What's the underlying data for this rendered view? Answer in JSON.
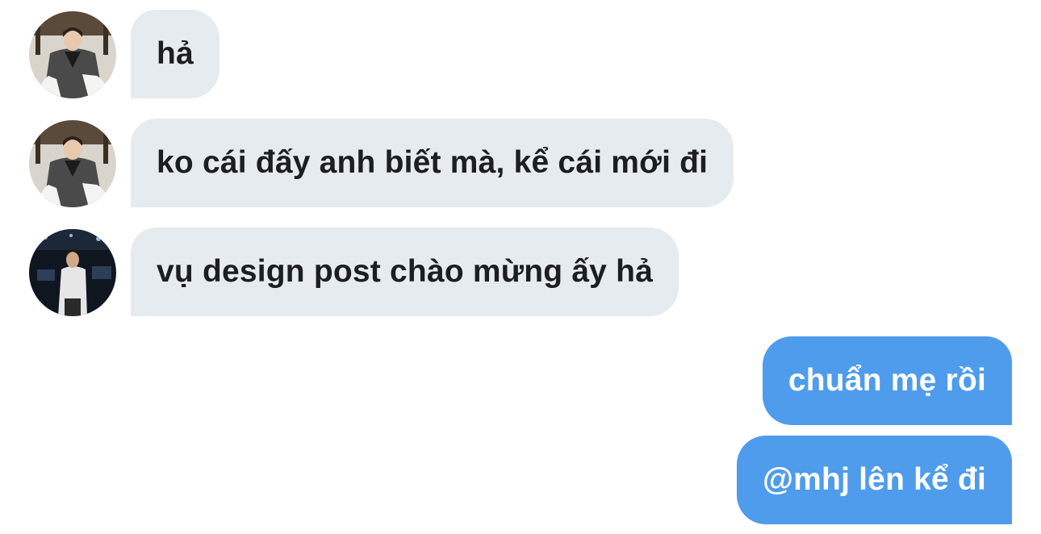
{
  "conversation": {
    "messages": [
      {
        "direction": "incoming",
        "sender_avatar": "avatar-photo-man-jacket",
        "text": "hả"
      },
      {
        "direction": "incoming",
        "sender_avatar": "avatar-photo-man-jacket",
        "text": "ko cái đấy anh biết mà, kể cái mới đi"
      },
      {
        "direction": "incoming",
        "sender_avatar": "avatar-photo-man-stage-dark",
        "text": "vụ design post chào mừng ấy hả"
      },
      {
        "direction": "outgoing",
        "text": "chuẩn mẹ rồi"
      },
      {
        "direction": "outgoing",
        "text": "@mhj lên kể đi"
      }
    ]
  },
  "colors": {
    "incoming_bubble": "#e6ebef",
    "incoming_text": "#1c1e21",
    "outgoing_bubble": "#4e9ceb",
    "outgoing_text": "#ffffff",
    "background": "#ffffff"
  }
}
